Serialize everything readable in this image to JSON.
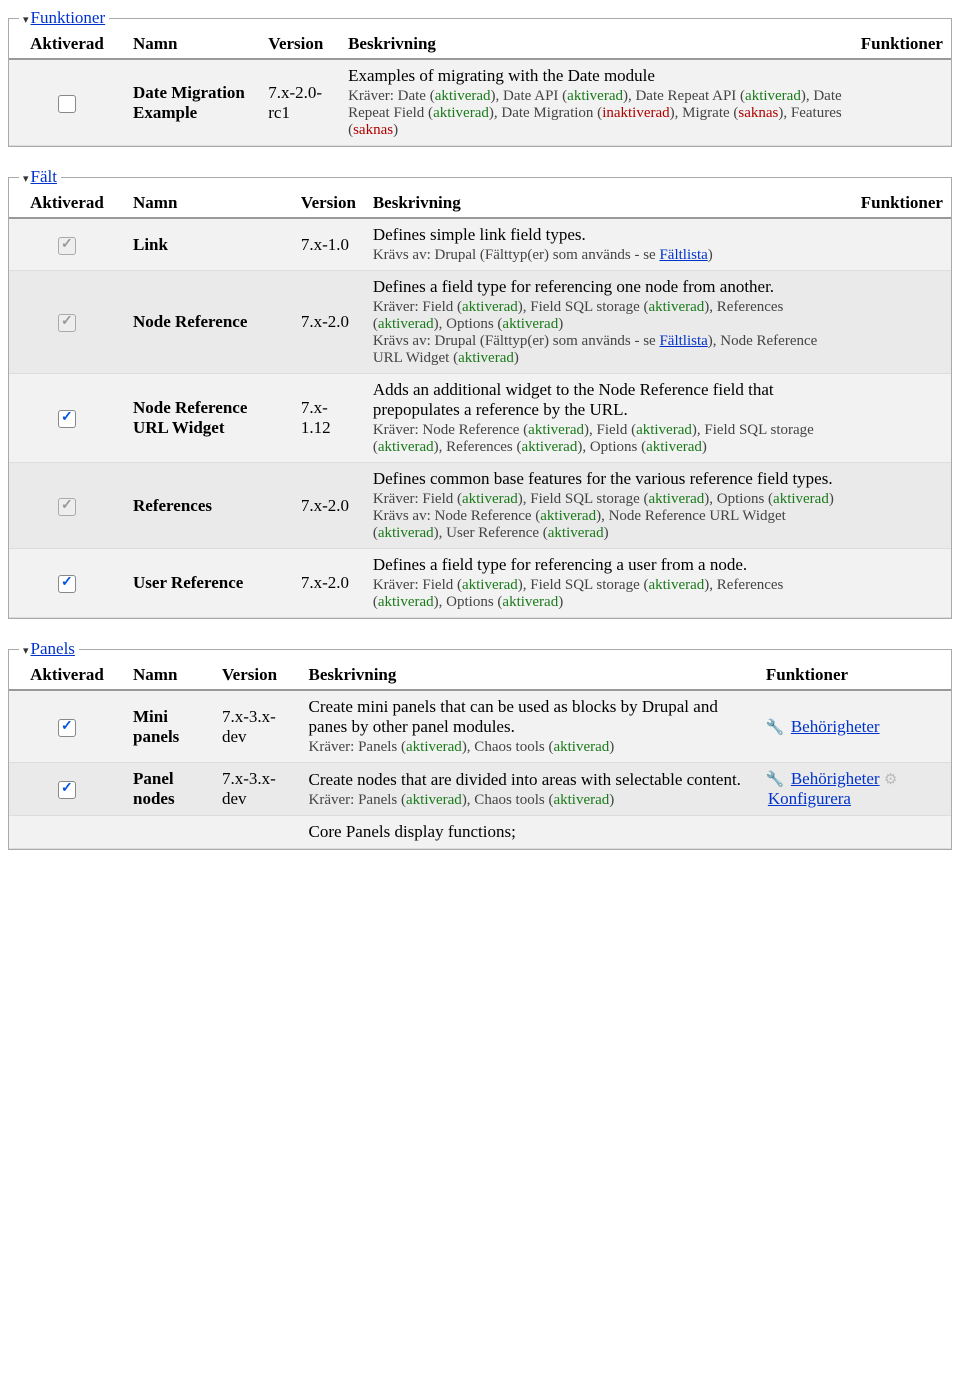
{
  "headers": {
    "enabled": "Aktiverad",
    "name": "Namn",
    "version": "Version",
    "description": "Beskrivning",
    "operations": "Funktioner"
  },
  "labels": {
    "requires": "Kräver",
    "required_by": "Krävs av",
    "fieldlist": "Fältlista",
    "permissions": "Behörigheter",
    "configure": "Konfigurera",
    "drupal_field_used": "Drupal (Fälttyp(er) som används - se "
  },
  "statuses": {
    "enabled": "aktiverad",
    "disabled": "inaktiverad",
    "missing": "saknas"
  },
  "groups": [
    {
      "id": "funktioner",
      "title": "Funktioner",
      "rows": [
        {
          "checkbox": "unchecked",
          "name": "Date Migration Example",
          "version": "7.x-2.0-rc1",
          "desc": "Examples of migrating with the Date module",
          "requires": [
            {
              "t": "Date",
              "s": "enabled"
            },
            {
              "t": "Date API",
              "s": "enabled"
            },
            {
              "t": "Date Repeat API",
              "s": "enabled"
            },
            {
              "t": "Date Repeat Field",
              "s": "enabled"
            },
            {
              "t": "Date Migration",
              "s": "disabled"
            },
            {
              "t": "Migrate",
              "s": "missing"
            },
            {
              "t": "Features",
              "s": "missing"
            }
          ]
        }
      ]
    },
    {
      "id": "falt",
      "title": "Fält",
      "rows": [
        {
          "checkbox": "locked-checked",
          "name": "Link",
          "version": "7.x-1.0",
          "desc": "Defines simple link field types.",
          "required_by_fieldlist": true
        },
        {
          "checkbox": "locked-checked",
          "name": "Node Reference",
          "version": "7.x-2.0",
          "desc": "Defines a field type for referencing one node from another.",
          "requires": [
            {
              "t": "Field",
              "s": "enabled"
            },
            {
              "t": "Field SQL storage",
              "s": "enabled"
            },
            {
              "t": "References",
              "s": "enabled"
            },
            {
              "t": "Options",
              "s": "enabled"
            }
          ],
          "required_by_fieldlist": true,
          "required_by_extra": [
            {
              "t": "Node Reference URL Widget",
              "s": "enabled"
            }
          ]
        },
        {
          "checkbox": "checked",
          "name": "Node Reference URL Widget",
          "version": "7.x-1.12",
          "desc": "Adds an additional widget to the Node Reference field that prepopulates a reference by the URL.",
          "requires": [
            {
              "t": "Node Reference",
              "s": "enabled"
            },
            {
              "t": "Field",
              "s": "enabled"
            },
            {
              "t": "Field SQL storage",
              "s": "enabled"
            },
            {
              "t": "References",
              "s": "enabled"
            },
            {
              "t": "Options",
              "s": "enabled"
            }
          ]
        },
        {
          "checkbox": "locked-checked",
          "name": "References",
          "version": "7.x-2.0",
          "desc": "Defines common base features for the various reference field types.",
          "requires": [
            {
              "t": "Field",
              "s": "enabled"
            },
            {
              "t": "Field SQL storage",
              "s": "enabled"
            },
            {
              "t": "Options",
              "s": "enabled"
            }
          ],
          "required_by_plain": [
            {
              "t": "Node Reference",
              "s": "enabled"
            },
            {
              "t": "Node Reference URL Widget",
              "s": "enabled"
            },
            {
              "t": "User Reference",
              "s": "enabled"
            }
          ]
        },
        {
          "checkbox": "checked",
          "name": "User Reference",
          "version": "7.x-2.0",
          "desc": "Defines a field type for referencing a user from a node.",
          "requires": [
            {
              "t": "Field",
              "s": "enabled"
            },
            {
              "t": "Field SQL storage",
              "s": "enabled"
            },
            {
              "t": "References",
              "s": "enabled"
            },
            {
              "t": "Options",
              "s": "enabled"
            }
          ]
        }
      ]
    },
    {
      "id": "panels",
      "title": "Panels",
      "rows": [
        {
          "checkbox": "checked",
          "name": "Mini panels",
          "version": "7.x-3.x-dev",
          "desc": "Create mini panels that can be used as blocks by Drupal and panes by other panel modules.",
          "requires": [
            {
              "t": "Panels",
              "s": "enabled"
            },
            {
              "t": "Chaos tools",
              "s": "enabled"
            }
          ],
          "ops": [
            "permissions"
          ]
        },
        {
          "checkbox": "checked",
          "name": "Panel nodes",
          "version": "7.x-3.x-dev",
          "desc": "Create nodes that are divided into areas with selectable content.",
          "requires": [
            {
              "t": "Panels",
              "s": "enabled"
            },
            {
              "t": "Chaos tools",
              "s": "enabled"
            }
          ],
          "ops": [
            "permissions",
            "configure"
          ]
        },
        {
          "checkbox": "partial",
          "name": "",
          "version": "",
          "desc": "Core Panels display functions;",
          "cutoff": true
        }
      ]
    }
  ]
}
